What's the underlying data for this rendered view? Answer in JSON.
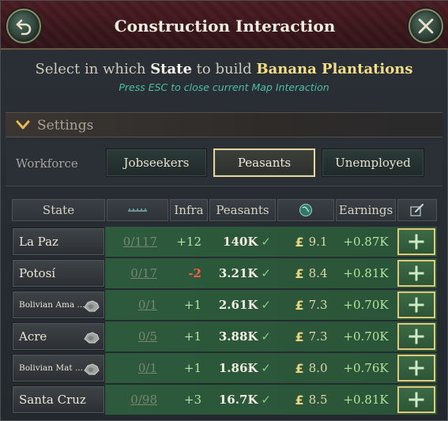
{
  "header": {
    "title": "Construction Interaction",
    "back_icon": "undo-arrow-icon",
    "close_icon": "close-icon"
  },
  "prompt": {
    "prefix": "Select in which",
    "state_word": "State",
    "middle": "to build",
    "building": "Banana Plantations",
    "esc_hint": "Press ESC to close current Map Interaction"
  },
  "settings": {
    "label": "Settings"
  },
  "workforce": {
    "label": "Workforce",
    "options": [
      "Jobseekers",
      "Peasants",
      "Unemployed"
    ],
    "selected": "Peasants"
  },
  "table": {
    "headers": {
      "state": "State",
      "arable_icon": "arable-land-icon",
      "infra": "Infra",
      "peasants": "Peasants",
      "wage_icon": "globe-icon",
      "earnings": "Earnings",
      "build_icon": "edit-icon"
    },
    "rows": [
      {
        "state": "La Paz",
        "small": false,
        "gear": false,
        "used": "0",
        "cap": "117",
        "infra": "+12",
        "neg": false,
        "peasants": "140K",
        "wage": "9.1",
        "earnings": "+0.87K"
      },
      {
        "state": "Potosí",
        "small": false,
        "gear": false,
        "used": "0",
        "cap": "17",
        "infra": "-2",
        "neg": true,
        "peasants": "3.21K",
        "wage": "8.4",
        "earnings": "+0.81K"
      },
      {
        "state": "Bolivian Ama ...",
        "small": true,
        "gear": true,
        "used": "0",
        "cap": "1",
        "infra": "+1",
        "neg": false,
        "peasants": "2.61K",
        "wage": "7.3",
        "earnings": "+0.70K"
      },
      {
        "state": "Acre",
        "small": false,
        "gear": true,
        "used": "0",
        "cap": "5",
        "infra": "+1",
        "neg": false,
        "peasants": "3.88K",
        "wage": "7.3",
        "earnings": "+0.70K"
      },
      {
        "state": "Bolivian Mat ...",
        "small": true,
        "gear": true,
        "used": "0",
        "cap": "1",
        "infra": "+1",
        "neg": false,
        "peasants": "1.86K",
        "wage": "8.0",
        "earnings": "+0.76K"
      },
      {
        "state": "Santa Cruz",
        "small": false,
        "gear": false,
        "used": "0",
        "cap": "98",
        "infra": "+3",
        "neg": false,
        "peasants": "16.7K",
        "wage": "8.5",
        "earnings": "+0.81K"
      }
    ],
    "currency_symbol": "£",
    "check_symbol": "✓"
  }
}
